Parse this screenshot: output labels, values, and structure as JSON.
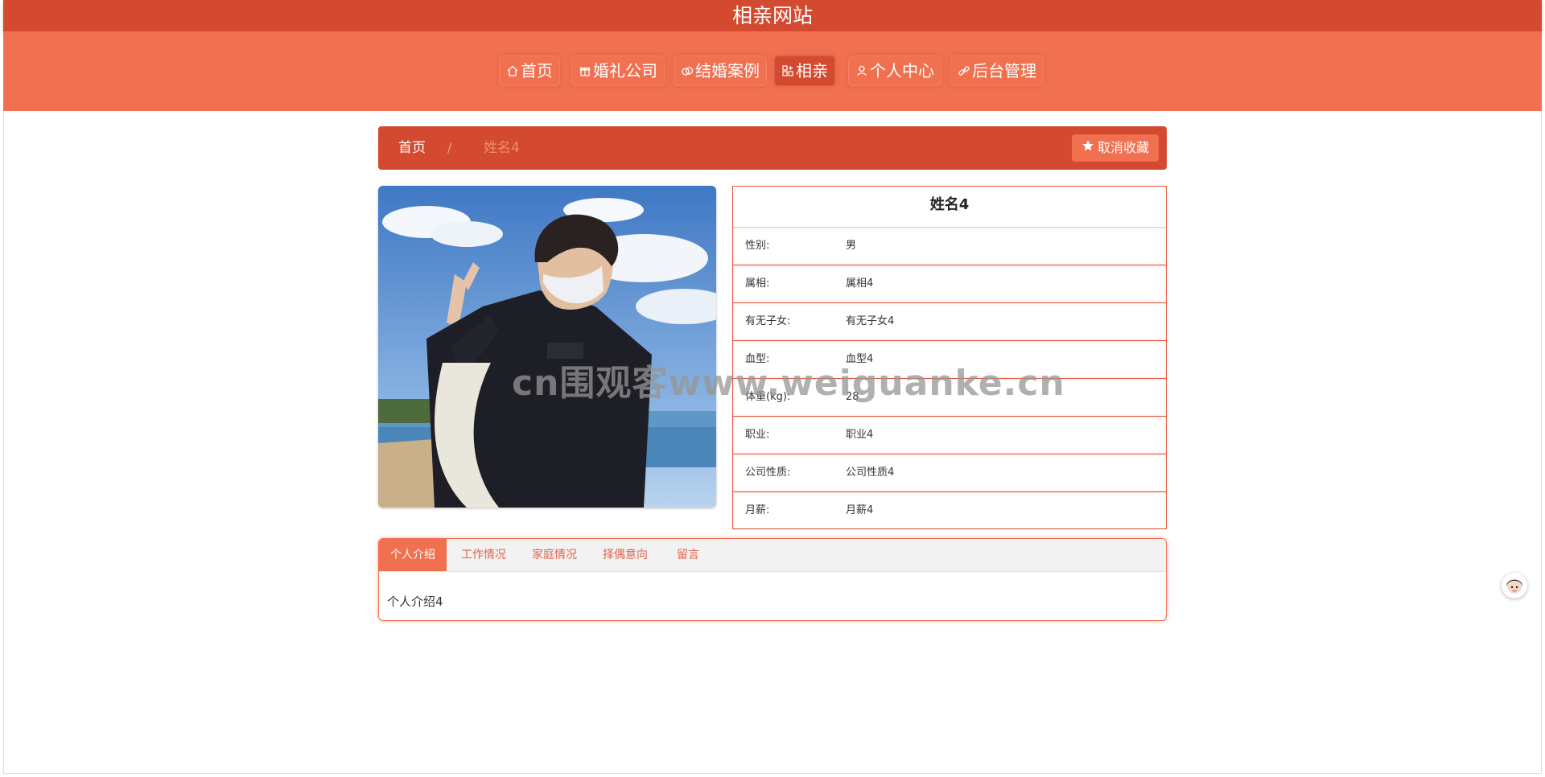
{
  "site": {
    "title": "相亲网站"
  },
  "nav": {
    "items": [
      {
        "label": "首页",
        "icon": "home-icon",
        "active": false
      },
      {
        "label": "婚礼公司",
        "icon": "gift-icon",
        "active": false
      },
      {
        "label": "结婚案例",
        "icon": "rings-icon",
        "active": false
      },
      {
        "label": "相亲",
        "icon": "apps-icon",
        "active": true
      },
      {
        "label": "个人中心",
        "icon": "user-icon",
        "active": false
      },
      {
        "label": "后台管理",
        "icon": "link-icon",
        "active": false
      }
    ]
  },
  "breadcrumb": {
    "home": "首页",
    "separator": "/",
    "current": "姓名4"
  },
  "favorite_button": {
    "label": "取消收藏",
    "icon": "star-icon"
  },
  "profile": {
    "name": "姓名4",
    "fields": [
      {
        "key": "性别:",
        "value": "男"
      },
      {
        "key": "属相:",
        "value": "属相4"
      },
      {
        "key": "有无子女:",
        "value": "有无子女4"
      },
      {
        "key": "血型:",
        "value": "血型4"
      },
      {
        "key": "体重(kg):",
        "value": "28"
      },
      {
        "key": "职业:",
        "value": "职业4"
      },
      {
        "key": "公司性质:",
        "value": "公司性质4"
      },
      {
        "key": "月薪:",
        "value": "月薪4"
      }
    ]
  },
  "tabs": {
    "items": [
      "个人介绍",
      "工作情况",
      "家庭情况",
      "择偶意向",
      "留言"
    ],
    "active_index": 0,
    "content": "个人介绍4"
  },
  "watermark": "cn围观客www.weiguanke.cn",
  "colors": {
    "primary": "#d44a30",
    "accent": "#f07050",
    "border": "#e0513a"
  }
}
